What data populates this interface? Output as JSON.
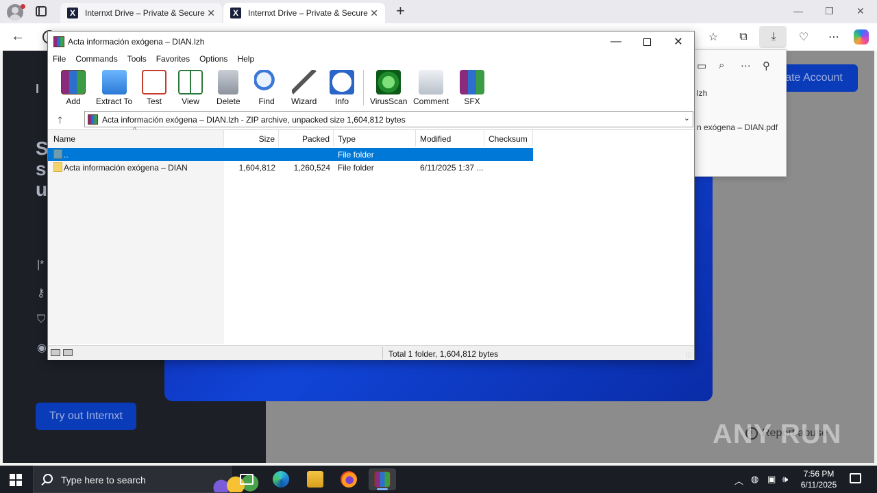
{
  "browser": {
    "tabs": [
      {
        "title": "Internxt Drive – Private & Secure",
        "favicon": "X"
      },
      {
        "title": "Internxt Drive – Private & Secure",
        "favicon": "X"
      }
    ]
  },
  "webpage": {
    "brand": "I N",
    "hero_lines": [
      "S",
      "s",
      "u"
    ],
    "try_button": "Try out Internxt",
    "create_account": "ate Account",
    "report_abuse": "Report abuse",
    "watermark": "ANY RUN"
  },
  "downloads_panel": {
    "item1": "lzh",
    "item2": "n exógena – DIAN.pdf"
  },
  "winrar": {
    "title": "Acta información exógena – DIAN.lzh",
    "menu": [
      "File",
      "Commands",
      "Tools",
      "Favorites",
      "Options",
      "Help"
    ],
    "tools": [
      {
        "label": "Add",
        "icon": "add-icon"
      },
      {
        "label": "Extract To",
        "icon": "extract-icon"
      },
      {
        "label": "Test",
        "icon": "test-icon"
      },
      {
        "label": "View",
        "icon": "view-icon"
      },
      {
        "label": "Delete",
        "icon": "delete-icon"
      },
      {
        "label": "Find",
        "icon": "find-icon"
      },
      {
        "label": "Wizard",
        "icon": "wizard-icon"
      },
      {
        "label": "Info",
        "icon": "info-icon"
      },
      {
        "label": "VirusScan",
        "icon": "virusscan-icon"
      },
      {
        "label": "Comment",
        "icon": "comment-icon"
      },
      {
        "label": "SFX",
        "icon": "sfx-icon"
      }
    ],
    "path": "Acta información exógena – DIAN.lzh - ZIP archive, unpacked size 1,604,812 bytes",
    "columns": [
      "Name",
      "Size",
      "Packed",
      "Type",
      "Modified",
      "Checksum"
    ],
    "rows": [
      {
        "name": "..",
        "size": "",
        "packed": "",
        "type": "File folder",
        "modified": "",
        "checksum": "",
        "selected": true
      },
      {
        "name": "Acta información exógena – DIAN",
        "size": "1,604,812",
        "packed": "1,260,524",
        "type": "File folder",
        "modified": "6/11/2025 1:37 ...",
        "checksum": "",
        "selected": false
      }
    ],
    "status": "Total 1 folder, 1,604,812 bytes"
  },
  "taskbar": {
    "search_placeholder": "Type here to search",
    "time": "7:56 PM",
    "date": "6/11/2025"
  },
  "colors": {
    "selection": "#0078d7",
    "taskbar": "#1a1d24",
    "hero_blue": "#1144d6"
  }
}
